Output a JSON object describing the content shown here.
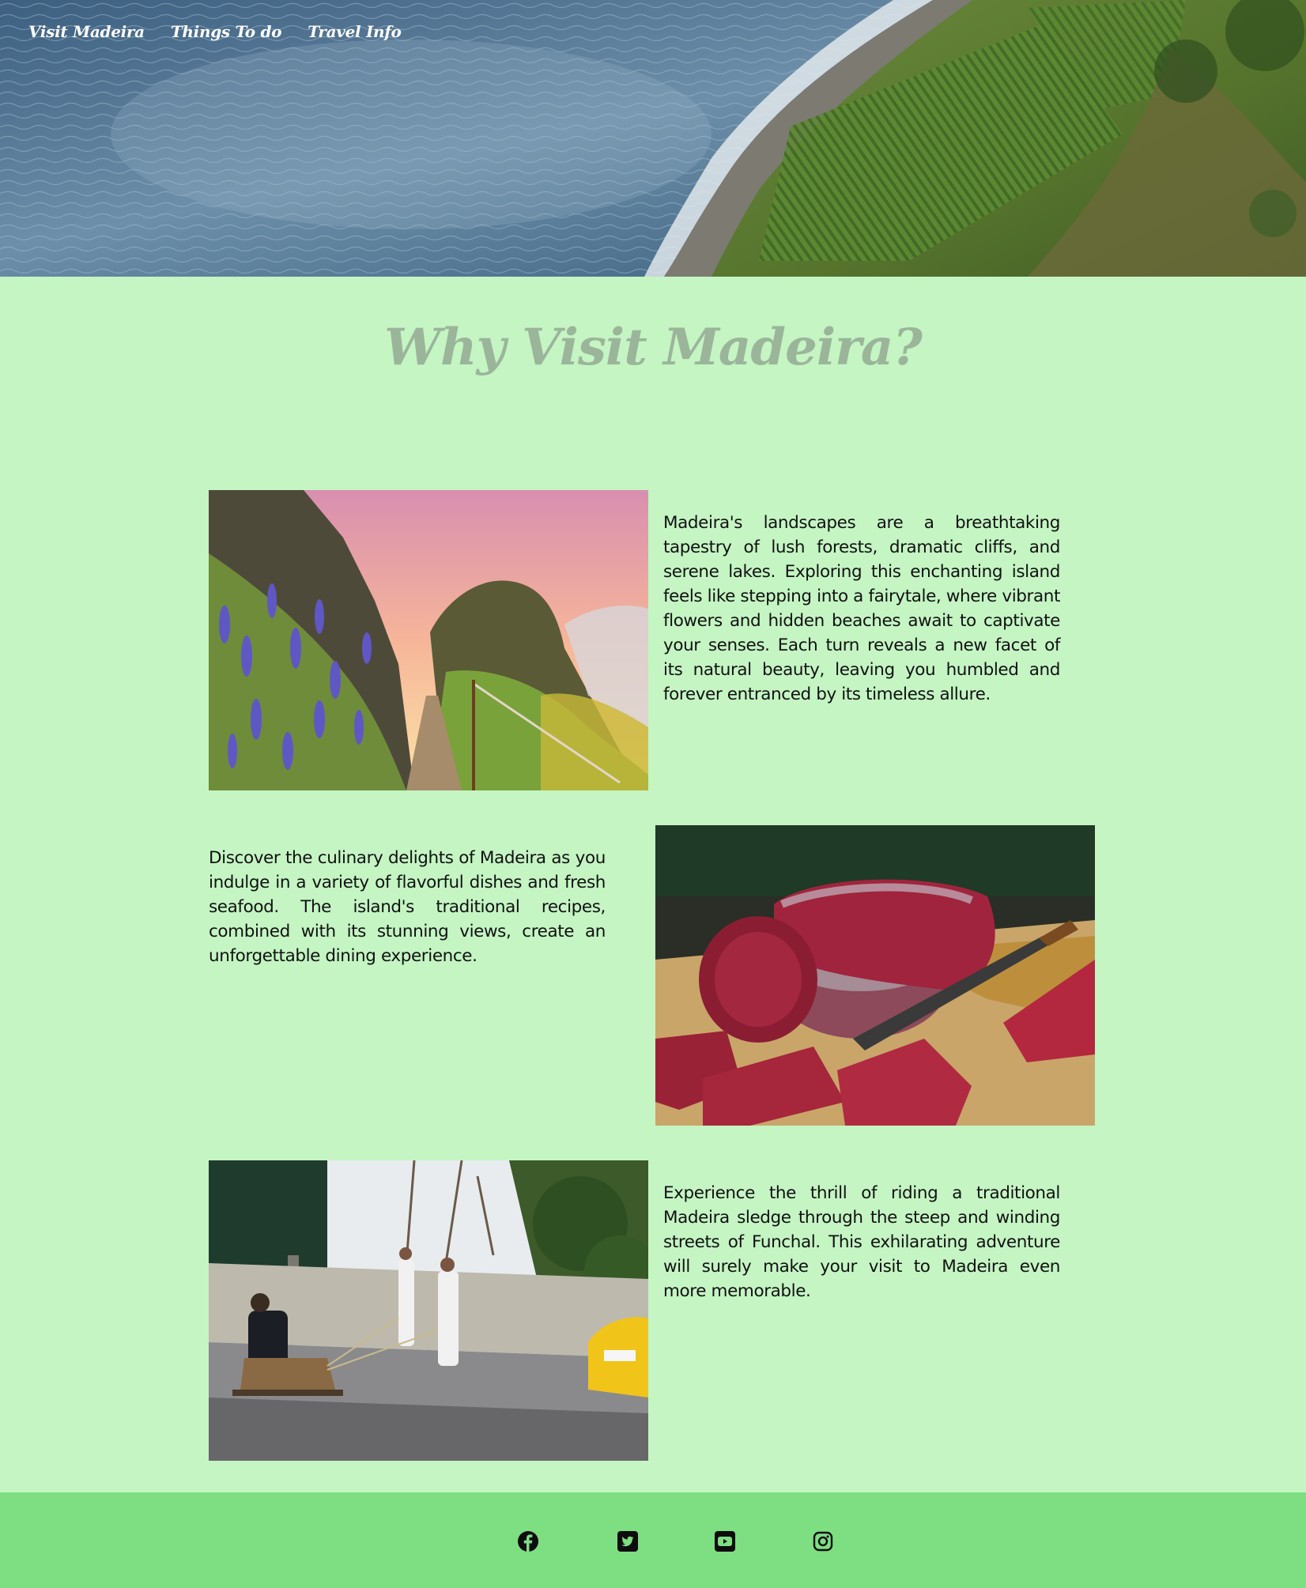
{
  "nav": {
    "items": [
      "Visit Madeira",
      "Things To do",
      "Travel Info"
    ]
  },
  "page": {
    "title": "Why Visit Madeira?"
  },
  "sections": [
    {
      "image": "madeira-flower-path-photo",
      "text": "Madeira's landscapes are a breathtaking tapestry of lush forests, dramatic cliffs, and serene lakes. Exploring this enchanting island feels like stepping into a fairytale, where vibrant flowers and hidden beaches await to captivate your senses. Each turn reveals a new facet of its natural beauty, leaving you humbled and forever entranced by its timeless allure."
    },
    {
      "image": "fresh-tuna-photo",
      "text": "Discover the culinary delights of Madeira as you indulge in a variety of flavorful dishes and fresh seafood. The island's traditional recipes, combined with its stunning views, create an unforgettable dining experience."
    },
    {
      "image": "toboggan-sledge-photo",
      "text": "Experience the thrill of riding a traditional Madeira sledge through the steep and winding streets of Funchal. This exhilarating adventure will surely make your visit to Madeira even more memorable."
    }
  ],
  "footer": {
    "social": [
      "facebook-icon",
      "twitter-icon",
      "youtube-icon",
      "instagram-icon"
    ]
  },
  "colors": {
    "background": "#c4f5c3",
    "footer": "#7ede82",
    "title": "#9bb59a",
    "nav_text": "#ffffff"
  }
}
